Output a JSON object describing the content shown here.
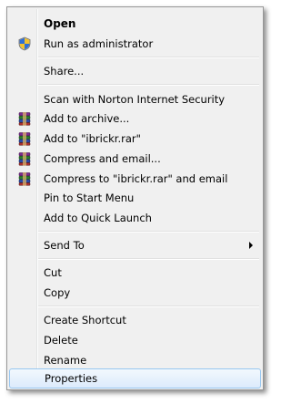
{
  "menu": {
    "items": [
      {
        "label": "Open",
        "icon": "none",
        "bold": true
      },
      {
        "label": "Run as administrator",
        "icon": "uac-shield-icon"
      },
      {
        "label": "Share...",
        "icon": "none"
      },
      {
        "label": "Scan with Norton Internet Security",
        "icon": "none"
      },
      {
        "label": "Add to archive...",
        "icon": "winrar-icon"
      },
      {
        "label": "Add to \"ibrickr.rar\"",
        "icon": "winrar-icon"
      },
      {
        "label": "Compress and email...",
        "icon": "winrar-icon"
      },
      {
        "label": "Compress to \"ibrickr.rar\" and email",
        "icon": "winrar-icon"
      },
      {
        "label": "Pin to Start Menu",
        "icon": "none"
      },
      {
        "label": "Add to Quick Launch",
        "icon": "none"
      },
      {
        "label": "Send To",
        "icon": "none",
        "submenu": true
      },
      {
        "label": "Cut",
        "icon": "none"
      },
      {
        "label": "Copy",
        "icon": "none"
      },
      {
        "label": "Create Shortcut",
        "icon": "none"
      },
      {
        "label": "Delete",
        "icon": "none"
      },
      {
        "label": "Rename",
        "icon": "none"
      },
      {
        "label": "Properties",
        "icon": "none",
        "highlighted": true
      }
    ]
  },
  "colors": {
    "menu_background": "#f0f0f0",
    "highlight_border": "#99c7f0",
    "highlight_fill": "#dcebfc"
  }
}
